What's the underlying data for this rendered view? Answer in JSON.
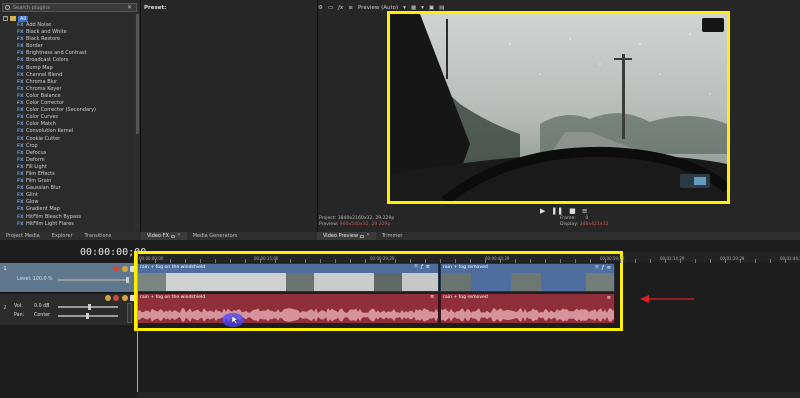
{
  "fx_browser": {
    "search_placeholder": "Search plugins",
    "root_label": "All",
    "items": [
      "Add Noise",
      "Black and White",
      "Black Restore",
      "Border",
      "Brightness and Contrast",
      "Broadcast Colors",
      "Bump Map",
      "Channel Blend",
      "Chroma Blur",
      "Chroma Keyer",
      "Color Balance",
      "Color Corrector",
      "Color Corrector (Secondary)",
      "Color Curves",
      "Color Match",
      "Convolution Kernel",
      "Cookie Cutter",
      "Crop",
      "Defocus",
      "Deform",
      "Fill Light",
      "Film Effects",
      "Film Grain",
      "Gaussian Blur",
      "Glint",
      "Glow",
      "Gradient Map",
      "HitFilm Bleach Bypass",
      "HitFilm Light Flares"
    ],
    "fx_prefix": "FX"
  },
  "left_tabs": [
    "Project Media",
    "Explorer",
    "Transitions"
  ],
  "preset": {
    "title": "Preset:"
  },
  "middle_tabs": [
    "Video FX",
    "Media Generators"
  ],
  "preview": {
    "mode_label": "Preview (Auto)",
    "project_label": "Project:",
    "project_value": "3840x2160x32, 29.229p",
    "preview_label": "Preview:",
    "preview_value": "960x540x32, 29.229p",
    "frame_label": "Frame:",
    "frame_value": "0",
    "display_label": "Display:",
    "display_value": "348x421x32"
  },
  "right_tabs": [
    "Video Preview",
    "Trimmer"
  ],
  "timeline": {
    "timecode": "00:00:00;00",
    "ruler_labels": [
      "00:00:00;00",
      "00:00:15;00",
      "00:00:29;29",
      "00:00:44;29",
      "00:00:59;28",
      "00:01:14;29",
      "00:01:29;28",
      "00:01:44;29"
    ],
    "video_track": {
      "number": "1",
      "level_label": "Level: 100.0 %"
    },
    "audio_track": {
      "number": "2",
      "vol_label": "Vol:",
      "vol_value": "0.0 dB",
      "pan_label": "Pan:",
      "pan_value": "Center"
    },
    "clips": {
      "video_a": "rain + fog on the windshield",
      "video_b": "rain + fog removed",
      "audio_a": "rain + fog on the windshield",
      "audio_b": "rain + fog removed"
    }
  },
  "colors": {
    "highlight": "#fff000",
    "video_clip": "#4d6e9f",
    "audio_clip": "#8f2f3a",
    "arrow": "#e02020"
  }
}
